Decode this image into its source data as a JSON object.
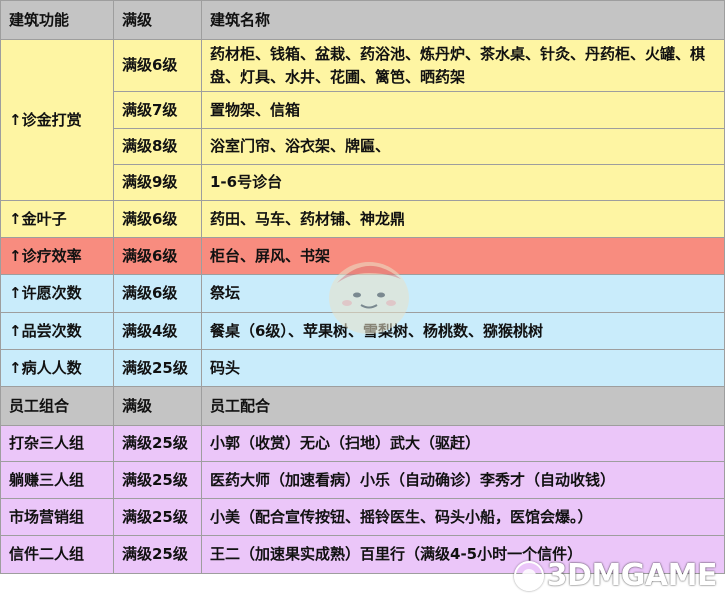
{
  "building_section": {
    "header": {
      "function": "建筑功能",
      "level": "满级",
      "name": "建筑名称"
    },
    "groups": [
      {
        "function": "↑诊金打赏",
        "rows": [
          {
            "level": "满级6级",
            "buildings": "药材柜、钱箱、盆栽、药浴池、炼丹炉、茶水桌、针灸、丹药柜、火罐、棋盘、灯具、水井、花圃、篱笆、晒药架"
          },
          {
            "level": "满级7级",
            "buildings": "置物架、信箱"
          },
          {
            "level": "满级8级",
            "buildings": "浴室门帘、浴衣架、牌匾、"
          },
          {
            "level": "满级9级",
            "buildings": "1-6号诊台"
          }
        ]
      },
      {
        "function": "↑金叶子",
        "rows": [
          {
            "level": "满级6级",
            "buildings": "药田、马车、药材铺、神龙鼎"
          }
        ]
      },
      {
        "function": "↑诊疗效率",
        "rows": [
          {
            "level": "满级6级",
            "buildings": "柜台、屏风、书架"
          }
        ]
      },
      {
        "function": "↑许愿次数",
        "rows": [
          {
            "level": "满级6级",
            "buildings": "祭坛"
          }
        ]
      },
      {
        "function": "↑品尝次数",
        "rows": [
          {
            "level": "满级4级",
            "buildings": "餐桌（6级）、苹果树、雪梨树、杨桃数、猕猴桃树"
          }
        ]
      },
      {
        "function": "↑病人人数",
        "rows": [
          {
            "level": "满级25级",
            "buildings": "码头"
          }
        ]
      }
    ]
  },
  "staff_section": {
    "header": {
      "group": "员工组合",
      "level": "满级",
      "config": "员工配合"
    },
    "rows": [
      {
        "group": "打杂三人组",
        "level": "满级25级",
        "config": "小郭（收赏）无心（扫地）武大（驱赶）"
      },
      {
        "group": "躺赚三人组",
        "level": "满级25级",
        "config": "医药大师（加速看病）小乐（自动确诊）李秀才（自动收钱）"
      },
      {
        "group": "市场营销组",
        "level": "满级25级",
        "config": "小美（配合宣传按钮、摇铃医生、码头小船，医馆会爆。）"
      },
      {
        "group": "信件二人组",
        "level": "满级25级",
        "config": "王二（加速果实成熟）百里行（满级4-5小时一个信件）"
      }
    ]
  },
  "watermark": {
    "text": "3DMGAME",
    "icon": "globe-logo-icon",
    "color": "#ffffff"
  },
  "mascot": {
    "icon": "cartoon-mascot-icon"
  },
  "colors": {
    "header": "#c4c4c4",
    "yellow": "#fef5a3",
    "red": "#f88c7f",
    "blue": "#c9ecfb",
    "purple": "#ebc6f9",
    "border": "#9e9e9e"
  }
}
